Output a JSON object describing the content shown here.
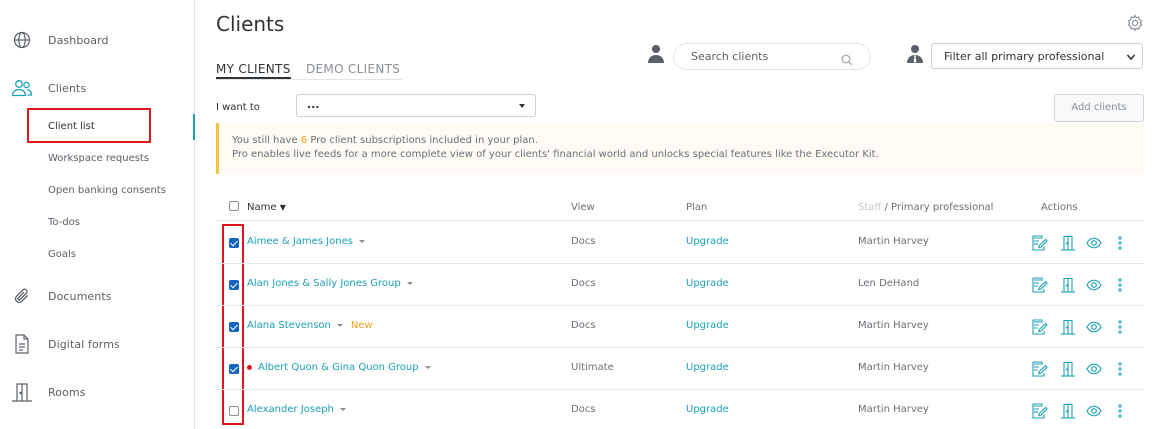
{
  "sidebar": {
    "items": [
      {
        "label": "Dashboard",
        "icon": "globe-icon"
      },
      {
        "label": "Clients",
        "icon": "users-icon"
      },
      {
        "label": "Documents",
        "icon": "paperclip-icon"
      },
      {
        "label": "Digital forms",
        "icon": "document-icon"
      },
      {
        "label": "Rooms",
        "icon": "building-icon"
      }
    ],
    "subitems": [
      "Client list",
      "Workspace requests",
      "Open banking consents",
      "To-dos",
      "Goals"
    ]
  },
  "header": {
    "title": "Clients",
    "settings_icon": "gear-icon"
  },
  "tabs": {
    "my_clients": "MY CLIENTS",
    "demo_clients": "DEMO CLIENTS"
  },
  "search": {
    "placeholder": "Search clients",
    "icon": "search-icon"
  },
  "filter": {
    "value": "Filter all primary professional",
    "icon": "person-tie-icon"
  },
  "toolbar": {
    "i_want_to_label": "I want to",
    "select_value": "...",
    "add_clients_label": "Add clients"
  },
  "banner": {
    "line1_pre": "You still have ",
    "line1_count": "6",
    "line1_post": " Pro client subscriptions included in your plan.",
    "line2": "Pro enables live feeds for a more complete view of your clients' financial world and unlocks special features like the Executor Kit."
  },
  "table": {
    "headers": {
      "name": "Name",
      "view": "View",
      "plan": "Plan",
      "staff": "Staff",
      "primary": " / Primary professional",
      "actions": "Actions"
    },
    "rows": [
      {
        "name": "Aimee & James Jones",
        "view": "Docs",
        "plan": "Upgrade",
        "staff": "Martin Harvey",
        "checked": true,
        "tag": "",
        "dot": false
      },
      {
        "name": "Alan Jones & Sally Jones Group",
        "view": "Docs",
        "plan": "Upgrade",
        "staff": "Len DeHand",
        "checked": true,
        "tag": "",
        "dot": false
      },
      {
        "name": "Alana Stevenson",
        "view": "Docs",
        "plan": "Upgrade",
        "staff": "Martin Harvey",
        "checked": true,
        "tag": "New",
        "dot": false
      },
      {
        "name": "Albert Quon & Gina Quon Group",
        "view": "Ultimate",
        "plan": "Upgrade",
        "staff": "Martin Harvey",
        "checked": true,
        "tag": "",
        "dot": true
      },
      {
        "name": "Alexander Joseph",
        "view": "Docs",
        "plan": "Upgrade",
        "staff": "Martin Harvey",
        "checked": false,
        "tag": "",
        "dot": false
      }
    ],
    "action_icons": [
      "edit-icon",
      "room-icon",
      "eye-icon",
      "more-vertical-icon"
    ]
  },
  "colors": {
    "accent": "#1ba1b8",
    "highlight": "#f0a01e",
    "annotation_red": "#e0141c",
    "checkbox_blue": "#1565c0"
  }
}
